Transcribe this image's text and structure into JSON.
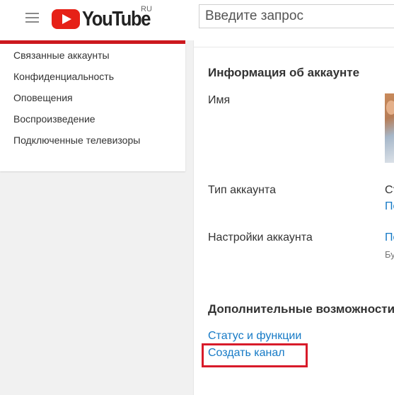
{
  "header": {
    "logo_text": "YouTube",
    "region": "RU",
    "search_placeholder": "Введите запрос"
  },
  "sidebar": {
    "items": [
      {
        "label": "Связанные аккаунты"
      },
      {
        "label": "Конфиденциальность"
      },
      {
        "label": "Оповещения"
      },
      {
        "label": "Воспроизведение"
      },
      {
        "label": "Подключенные телевизоры"
      }
    ]
  },
  "main": {
    "account_info_title": "Информация об аккаунте",
    "name_label": "Имя",
    "account_type_label": "Тип аккаунта",
    "account_type_value_partial": "Ст",
    "account_type_link_partial": "По",
    "account_settings_label": "Настройки аккаунта",
    "account_settings_link_partial": "По",
    "account_settings_sub_partial": "Бу",
    "extra_title": "Дополнительные возможности",
    "status_link": "Статус и функции",
    "create_channel_link": "Создать канал"
  },
  "colors": {
    "brand_red": "#e62117",
    "link_blue": "#167ac6",
    "highlight_red": "#d81b2a"
  },
  "icons": {
    "menu": "hamburger-menu-icon",
    "logo": "youtube-play-icon"
  }
}
